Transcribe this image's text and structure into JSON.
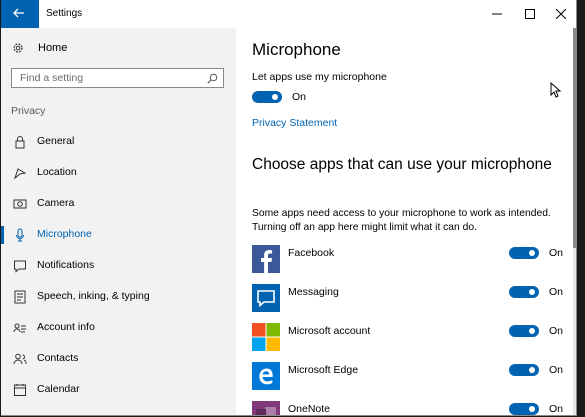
{
  "window": {
    "title": "Settings",
    "back_icon": "arrow-left-icon",
    "accent": "#0063b1"
  },
  "sidebar": {
    "home_label": "Home",
    "search_placeholder": "Find a setting",
    "group_label": "Privacy",
    "items": [
      {
        "label": "General",
        "icon": "lock-icon"
      },
      {
        "label": "Location",
        "icon": "location-icon"
      },
      {
        "label": "Camera",
        "icon": "camera-icon"
      },
      {
        "label": "Microphone",
        "icon": "microphone-icon",
        "active": true
      },
      {
        "label": "Notifications",
        "icon": "notifications-icon"
      },
      {
        "label": "Speech, inking, & typing",
        "icon": "speech-icon"
      },
      {
        "label": "Account info",
        "icon": "account-info-icon"
      },
      {
        "label": "Contacts",
        "icon": "contacts-icon"
      },
      {
        "label": "Calendar",
        "icon": "calendar-icon"
      }
    ]
  },
  "main": {
    "title": "Microphone",
    "master_toggle": {
      "label": "Let apps use my microphone",
      "state": "On"
    },
    "privacy_link": "Privacy Statement",
    "section_title": "Choose apps that can use your microphone",
    "section_desc": "Some apps need access to your microphone to work as intended. Turning off an app here might limit what it can do.",
    "apps": [
      {
        "name": "Facebook",
        "state": "On",
        "icon": "facebook-icon",
        "color": "#3b5998"
      },
      {
        "name": "Messaging",
        "state": "On",
        "icon": "messaging-icon",
        "color": "#0063b1"
      },
      {
        "name": "Microsoft account",
        "state": "On",
        "icon": "microsoft-icon",
        "color": "#f25022"
      },
      {
        "name": "Microsoft Edge",
        "state": "On",
        "icon": "edge-icon",
        "color": "#0078d7"
      },
      {
        "name": "OneNote",
        "state": "On",
        "icon": "onenote-icon",
        "color": "#80397b"
      }
    ]
  }
}
